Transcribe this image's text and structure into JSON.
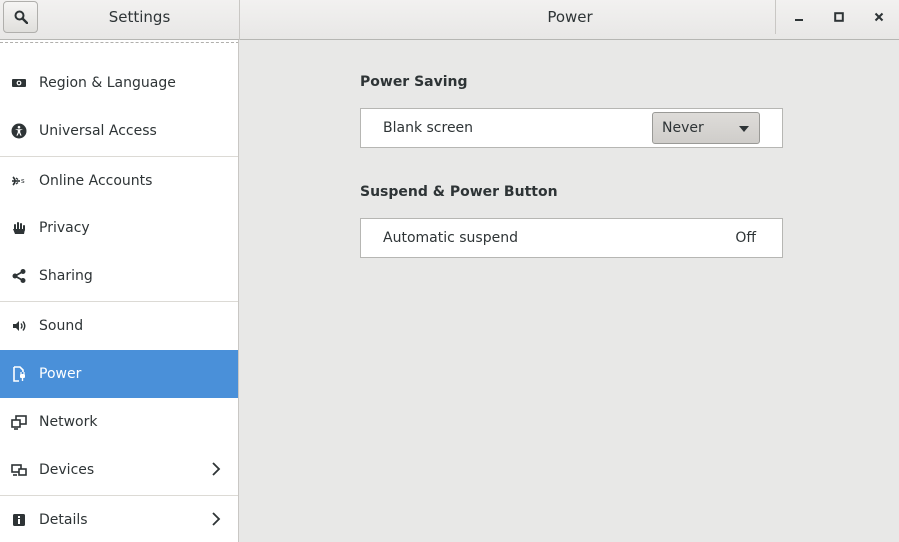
{
  "header": {
    "left_title": "Settings",
    "main_title": "Power",
    "search_icon": "search-icon",
    "window_controls": [
      "minimize-icon",
      "maximize-icon",
      "close-icon"
    ]
  },
  "sidebar": {
    "items": [
      {
        "label": "Region & Language",
        "icon": "region-icon"
      },
      {
        "label": "Universal Access",
        "icon": "accessibility-icon"
      },
      {
        "label": "Online Accounts",
        "icon": "online-accounts-icon"
      },
      {
        "label": "Privacy",
        "icon": "hand-icon"
      },
      {
        "label": "Sharing",
        "icon": "share-icon"
      },
      {
        "label": "Sound",
        "icon": "speaker-icon"
      },
      {
        "label": "Power",
        "icon": "power-icon",
        "active": true
      },
      {
        "label": "Network",
        "icon": "network-icon"
      },
      {
        "label": "Devices",
        "icon": "devices-icon",
        "has_submenu": true
      },
      {
        "label": "Details",
        "icon": "info-icon",
        "has_submenu": true
      }
    ]
  },
  "main": {
    "power_saving": {
      "title": "Power Saving",
      "blank_screen_label": "Blank screen",
      "blank_screen_value": "Never"
    },
    "suspend": {
      "title": "Suspend & Power Button",
      "automatic_suspend_label": "Automatic suspend",
      "automatic_suspend_value": "Off"
    }
  },
  "colors": {
    "accent": "#4a90d9",
    "panel_bg": "#e8e8e7",
    "sidebar_bg": "#ffffff"
  }
}
